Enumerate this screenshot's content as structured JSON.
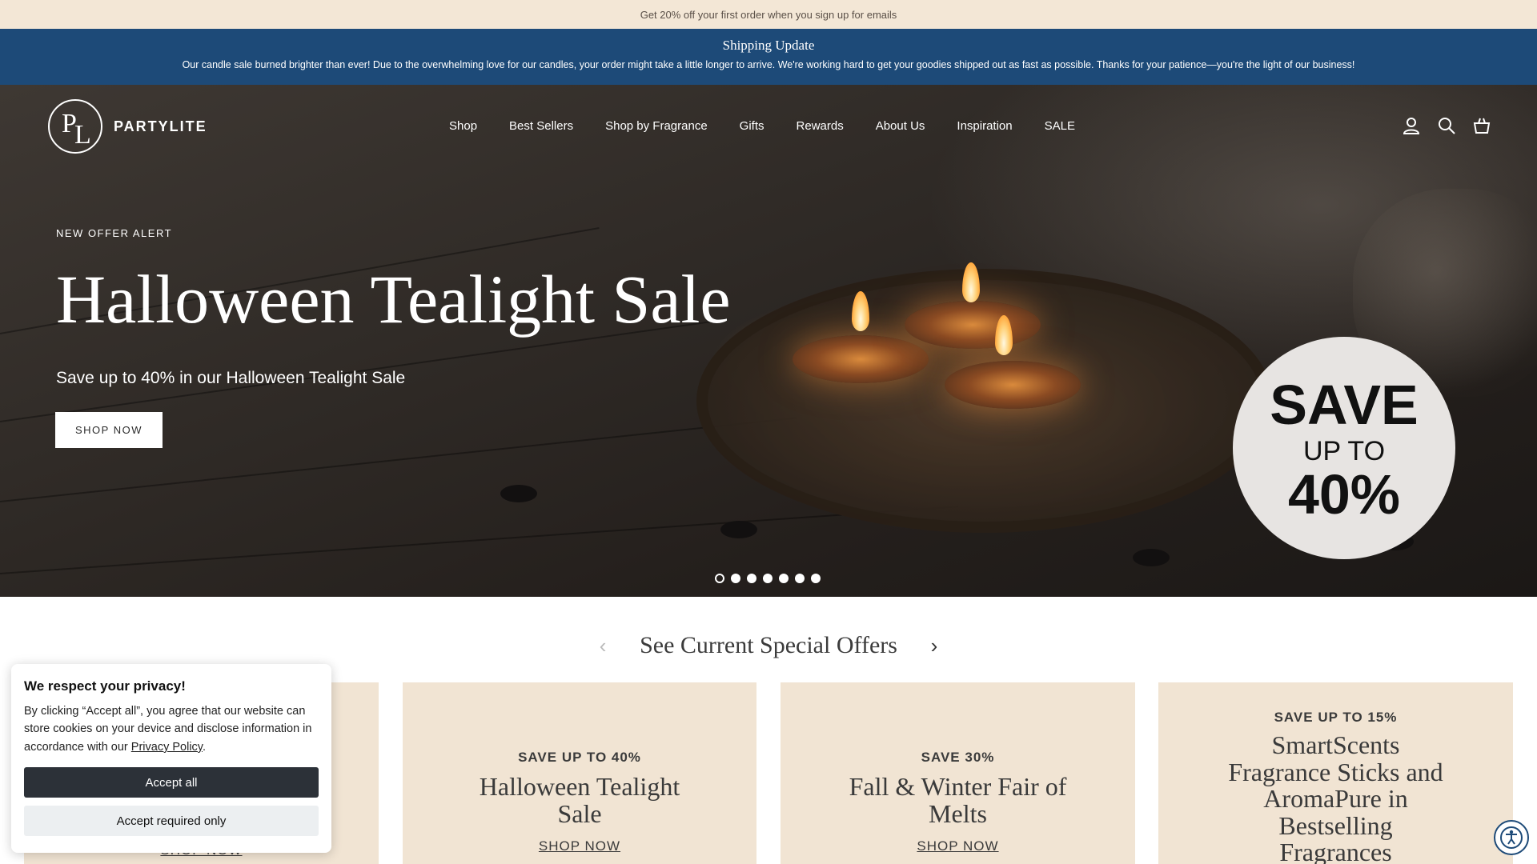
{
  "promo_bar": {
    "text": "Get 20% off your first order when you sign up for emails"
  },
  "shipping_banner": {
    "title": "Shipping Update",
    "message": "Our candle sale burned brighter than ever! Due to the overwhelming love for our candles, your order might take a little longer to arrive. We're working hard to get your goodies shipped out as fast as possible. Thanks for your patience—you're the light of our business!"
  },
  "header": {
    "brand": "PARTYLITE",
    "nav": [
      "Shop",
      "Best Sellers",
      "Shop by Fragrance",
      "Gifts",
      "Rewards",
      "About Us",
      "Inspiration",
      "SALE"
    ],
    "icons": [
      "account-icon",
      "search-icon",
      "cart-icon"
    ]
  },
  "hero": {
    "eyebrow": "NEW OFFER ALERT",
    "title": "Halloween Tealight Sale",
    "subtitle": "Save up to 40% in our Halloween Tealight Sale",
    "cta": "SHOP NOW",
    "badge": {
      "line1": "SAVE",
      "line2": "UP TO",
      "line3": "40%"
    },
    "slides_total": 7,
    "active_slide": 1
  },
  "offers": {
    "title": "See Current Special Offers",
    "cards": [
      {
        "kicker": "",
        "title": "",
        "link": "SHOP NOW"
      },
      {
        "kicker": "SAVE UP TO 40%",
        "title": "Halloween Tealight Sale",
        "link": "SHOP NOW"
      },
      {
        "kicker": "SAVE 30%",
        "title": "Fall & Winter Fair of Melts",
        "link": "SHOP NOW"
      },
      {
        "kicker": "SAVE UP TO 15%",
        "title": "SmartScents Fragrance Sticks and AromaPure in Bestselling Fragrances",
        "link": ""
      }
    ]
  },
  "cookie": {
    "title": "We respect your privacy!",
    "body_prefix": "By clicking “Accept all”, you agree that our website can store cookies on your device and disclose information in accordance with our ",
    "policy_link": "Privacy Policy",
    "body_suffix": ".",
    "accept_all": "Accept all",
    "accept_required": "Accept required only"
  },
  "colors": {
    "promo_bg": "#f3e7d6",
    "shipping_bg": "#1d4a78",
    "card_bg": "#f1e4d3",
    "cookie_primary": "#2c3138"
  }
}
